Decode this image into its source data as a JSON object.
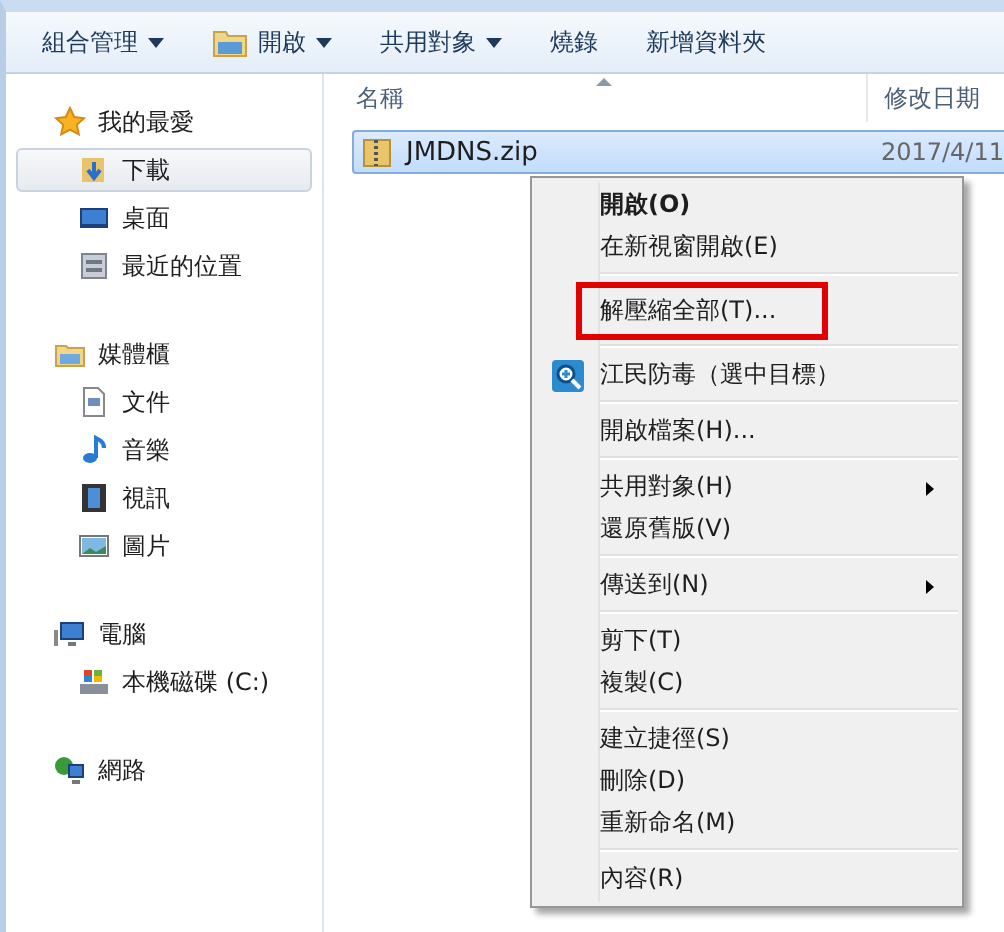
{
  "toolbar": [
    {
      "label": "組合管理",
      "kind": "dropdown"
    },
    {
      "label": "開啟",
      "kind": "icon-dropdown"
    },
    {
      "label": "共用對象",
      "kind": "dropdown"
    },
    {
      "label": "燒錄",
      "kind": "plain"
    },
    {
      "label": "新增資料夾",
      "kind": "plain"
    }
  ],
  "sidebar": {
    "groups": [
      {
        "label": "我的最愛",
        "kind": "star",
        "children": [
          {
            "label": "下載",
            "kind": "download",
            "selected": true
          },
          {
            "label": "桌面",
            "kind": "desktop",
            "selected": false
          },
          {
            "label": "最近的位置",
            "kind": "recent",
            "selected": false
          }
        ]
      },
      {
        "label": "媒體櫃",
        "kind": "library",
        "children": [
          {
            "label": "文件",
            "kind": "document",
            "selected": false
          },
          {
            "label": "音樂",
            "kind": "music",
            "selected": false
          },
          {
            "label": "視訊",
            "kind": "video",
            "selected": false
          },
          {
            "label": "圖片",
            "kind": "image",
            "selected": false
          }
        ]
      },
      {
        "label": "電腦",
        "kind": "computer",
        "children": [
          {
            "label": "本機磁碟 (C:)",
            "kind": "drive",
            "selected": false
          }
        ]
      },
      {
        "label": "網路",
        "kind": "network"
      }
    ]
  },
  "file_list": {
    "columns": [
      {
        "label": "名稱",
        "sorted": true
      },
      {
        "label": "修改日期",
        "sorted": false
      }
    ],
    "rows": [
      {
        "name": "JMDNS.zip",
        "date": "2017/4/11",
        "selected": true
      }
    ]
  },
  "context_menu": {
    "groups": [
      [
        {
          "label": "開啟(O)",
          "kind": "bold",
          "submenu": false,
          "highlighted": false
        },
        {
          "label": "在新視窗開啟(E)",
          "kind": "plain",
          "submenu": false,
          "highlighted": false
        }
      ],
      [
        {
          "label": "解壓縮全部(T)...",
          "kind": "plain",
          "submenu": false,
          "highlighted": true
        }
      ],
      [
        {
          "label": "江民防毒（選中目標）",
          "kind": "icon",
          "submenu": false,
          "highlighted": false
        }
      ],
      [
        {
          "label": "開啟檔案(H)...",
          "kind": "plain",
          "submenu": false,
          "highlighted": false
        }
      ],
      [
        {
          "label": "共用對象(H)",
          "kind": "plain",
          "submenu": true,
          "highlighted": false
        },
        {
          "label": "還原舊版(V)",
          "kind": "plain",
          "submenu": false,
          "highlighted": false
        }
      ],
      [
        {
          "label": "傳送到(N)",
          "kind": "plain",
          "submenu": true,
          "highlighted": false
        }
      ],
      [
        {
          "label": "剪下(T)",
          "kind": "plain",
          "submenu": false,
          "highlighted": false
        },
        {
          "label": "複製(C)",
          "kind": "plain",
          "submenu": false,
          "highlighted": false
        }
      ],
      [
        {
          "label": "建立捷徑(S)",
          "kind": "plain",
          "submenu": false,
          "highlighted": false
        },
        {
          "label": "刪除(D)",
          "kind": "plain",
          "submenu": false,
          "highlighted": false
        },
        {
          "label": "重新命名(M)",
          "kind": "plain",
          "submenu": false,
          "highlighted": false
        }
      ],
      [
        {
          "label": "內容(R)",
          "kind": "plain",
          "submenu": false,
          "highlighted": false
        }
      ]
    ]
  }
}
